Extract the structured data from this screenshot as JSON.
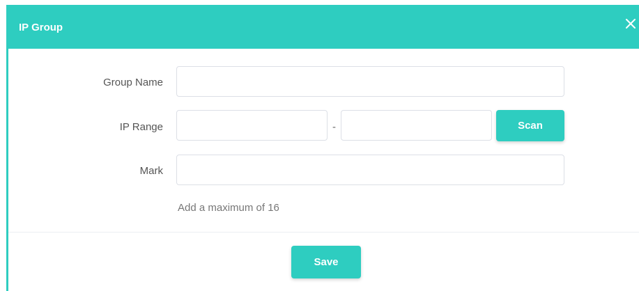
{
  "dialog": {
    "title": "IP Group",
    "close_icon": "close-icon"
  },
  "form": {
    "group_name": {
      "label": "Group Name",
      "value": "",
      "placeholder": ""
    },
    "ip_range": {
      "label": "IP Range",
      "start_value": "",
      "end_value": "",
      "separator": "-",
      "scan_label": "Scan"
    },
    "mark": {
      "label": "Mark",
      "value": "",
      "placeholder": ""
    },
    "hint": "Add a maximum of 16"
  },
  "footer": {
    "save_label": "Save"
  },
  "colors": {
    "accent": "#2ecdc0",
    "input_border": "#dcdfe6",
    "label_text": "#555555"
  }
}
